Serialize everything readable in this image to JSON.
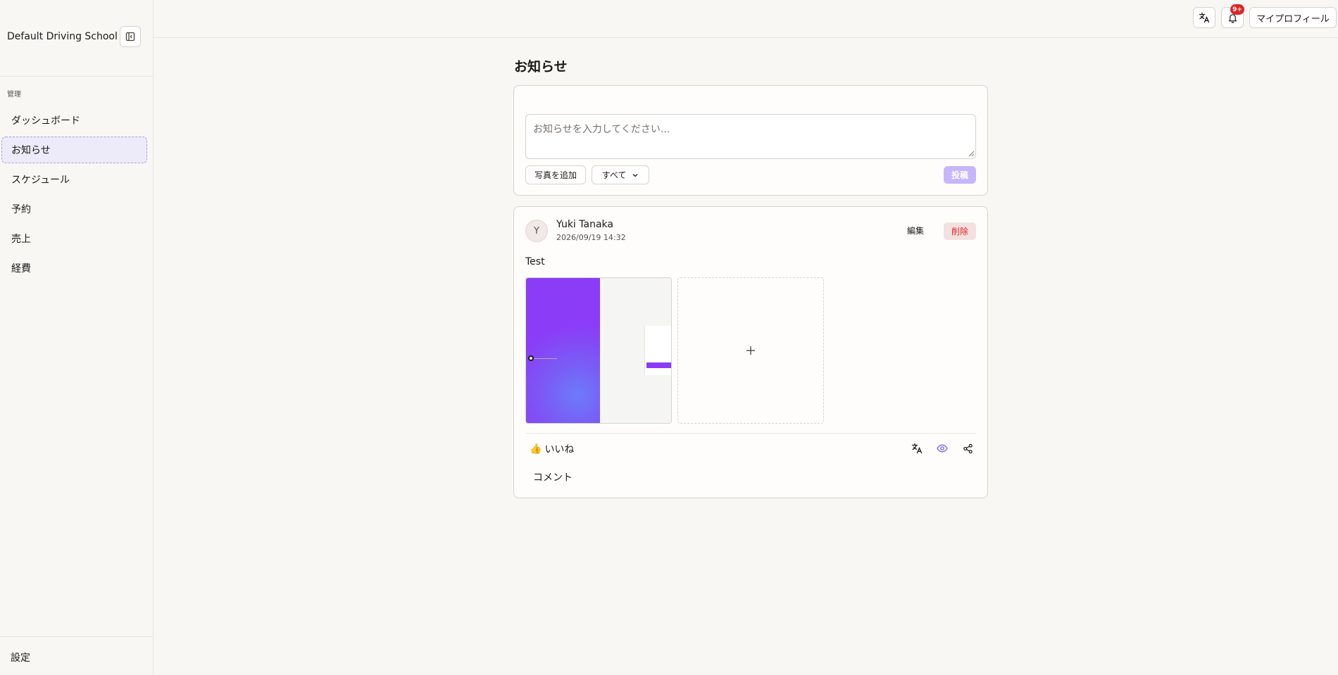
{
  "sidebar": {
    "brand": "Default Driving School",
    "section_label": "管理",
    "items": [
      {
        "label": "ダッシュボード",
        "active": false
      },
      {
        "label": "お知らせ",
        "active": true
      },
      {
        "label": "スケジュール",
        "active": false
      },
      {
        "label": "予約",
        "active": false
      },
      {
        "label": "売上",
        "active": false
      },
      {
        "label": "経費",
        "active": false
      }
    ],
    "settings_label": "設定"
  },
  "header": {
    "notification_badge": "9+",
    "profile_label": "マイプロフィール"
  },
  "main": {
    "title": "お知らせ",
    "compose": {
      "placeholder": "お知らせを入力してください...",
      "add_photo_label": "写真を追加",
      "audience_selected": "すべて",
      "submit_label": "投稿"
    },
    "post": {
      "avatar_initial": "Y",
      "author": "Yuki Tanaka",
      "timestamp": "2026/09/19 14:32",
      "edit_label": "編集",
      "delete_label": "削除",
      "body": "Test",
      "like_emoji": "👍",
      "like_label": "いいね",
      "comment_label": "コメント"
    }
  },
  "colors": {
    "accent": "#8b3cf7",
    "accent_light": "#c4b5fd",
    "danger": "#dc2626",
    "active_nav_bg": "#edeafa"
  }
}
